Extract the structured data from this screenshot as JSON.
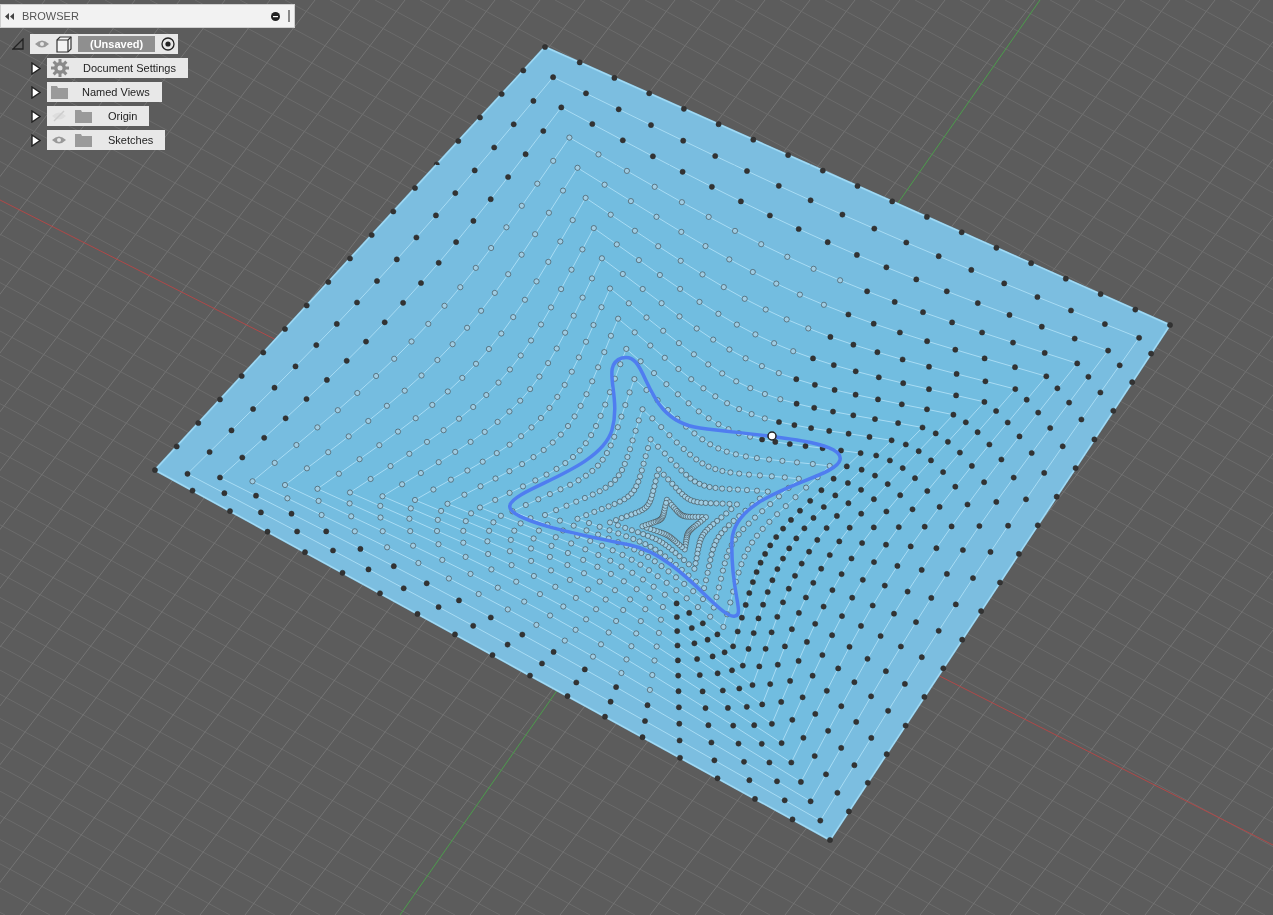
{
  "browser": {
    "title": "BROWSER",
    "root": {
      "label": "(Unsaved)",
      "expanded": true,
      "visible": true,
      "active": true,
      "children": [
        {
          "label": "Document Settings",
          "kind": "gear",
          "expanded": false
        },
        {
          "label": "Named Views",
          "kind": "folder",
          "expanded": false
        },
        {
          "label": "Origin",
          "kind": "folder",
          "expanded": false,
          "visible": false
        },
        {
          "label": "Sketches",
          "kind": "folder",
          "expanded": false,
          "visible": true
        }
      ]
    }
  }
}
